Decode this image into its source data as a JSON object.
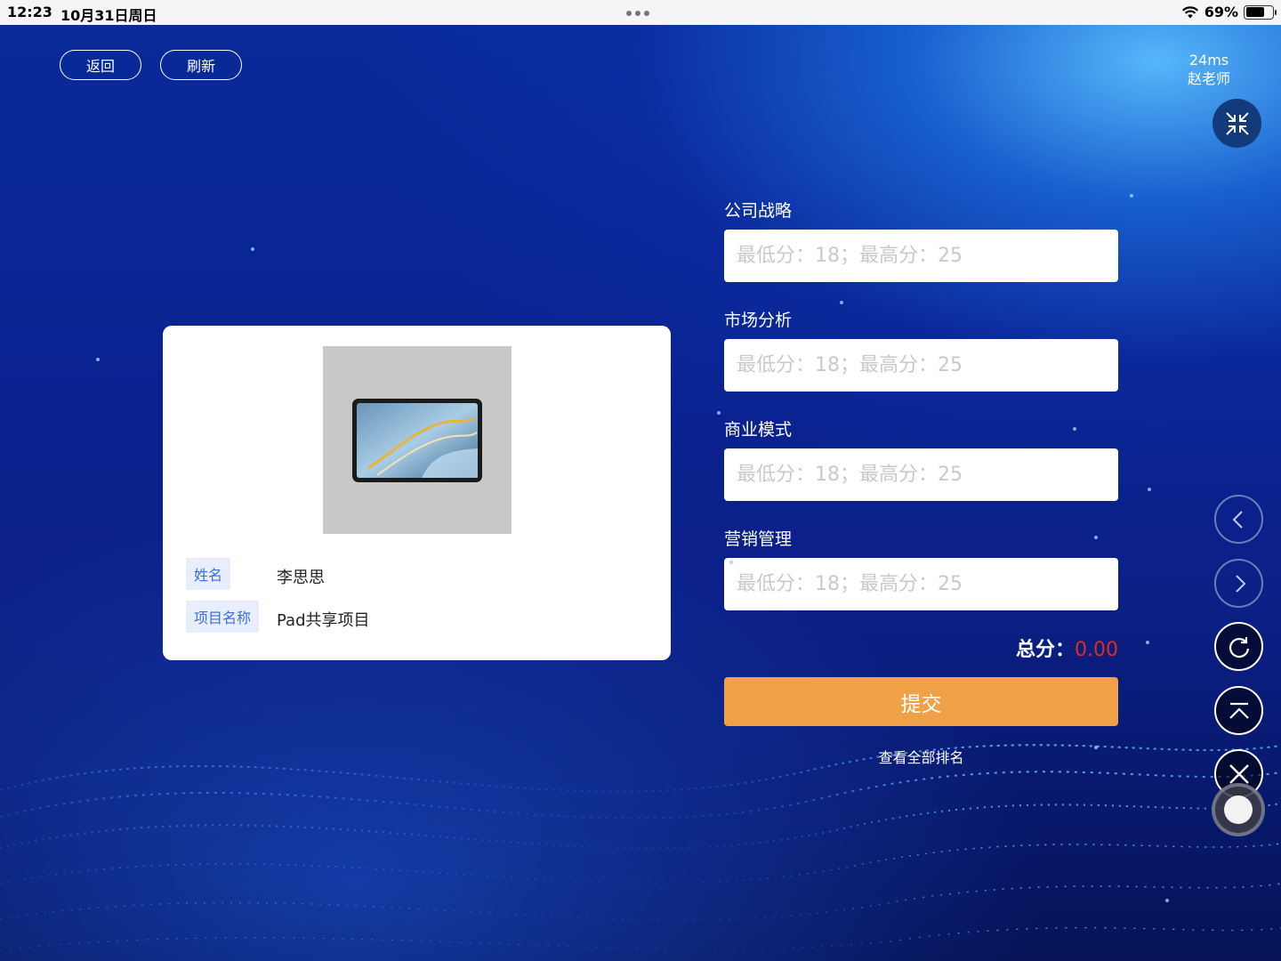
{
  "status_bar": {
    "time": "12:23",
    "date": "10月31日周日",
    "battery": "69%",
    "battery_level": 0.69
  },
  "toolbar": {
    "back_label": "返回",
    "refresh_label": "刷新",
    "latency": "24ms",
    "teacher": "赵老师"
  },
  "card": {
    "name_label": "姓名",
    "name_value": "李思思",
    "project_label": "项目名称",
    "project_value": "Pad共享项目"
  },
  "form": {
    "fields": [
      {
        "label": "公司战略",
        "placeholder": "最低分：18；最高分：25"
      },
      {
        "label": "市场分析",
        "placeholder": "最低分：18；最高分：25"
      },
      {
        "label": "商业模式",
        "placeholder": "最低分：18；最高分：25"
      },
      {
        "label": "营销管理",
        "placeholder": "最低分：18；最高分：25"
      }
    ],
    "total_label": "总分：",
    "total_value": "0.00",
    "submit_label": "提交",
    "ranking_link": "查看全部排名"
  },
  "colors": {
    "accent_orange": "#f0a046",
    "total_red": "#e02b1f",
    "tag_blue": "#3b6fd6",
    "tag_bg": "#e8eefb"
  },
  "icons": {
    "fullscreen": "exit-fullscreen-icon",
    "prev": "chevron-left-icon",
    "next": "chevron-right-icon",
    "reload": "reload-icon",
    "top": "scroll-top-icon",
    "close": "close-icon",
    "assistive": "assistive-touch-icon"
  }
}
